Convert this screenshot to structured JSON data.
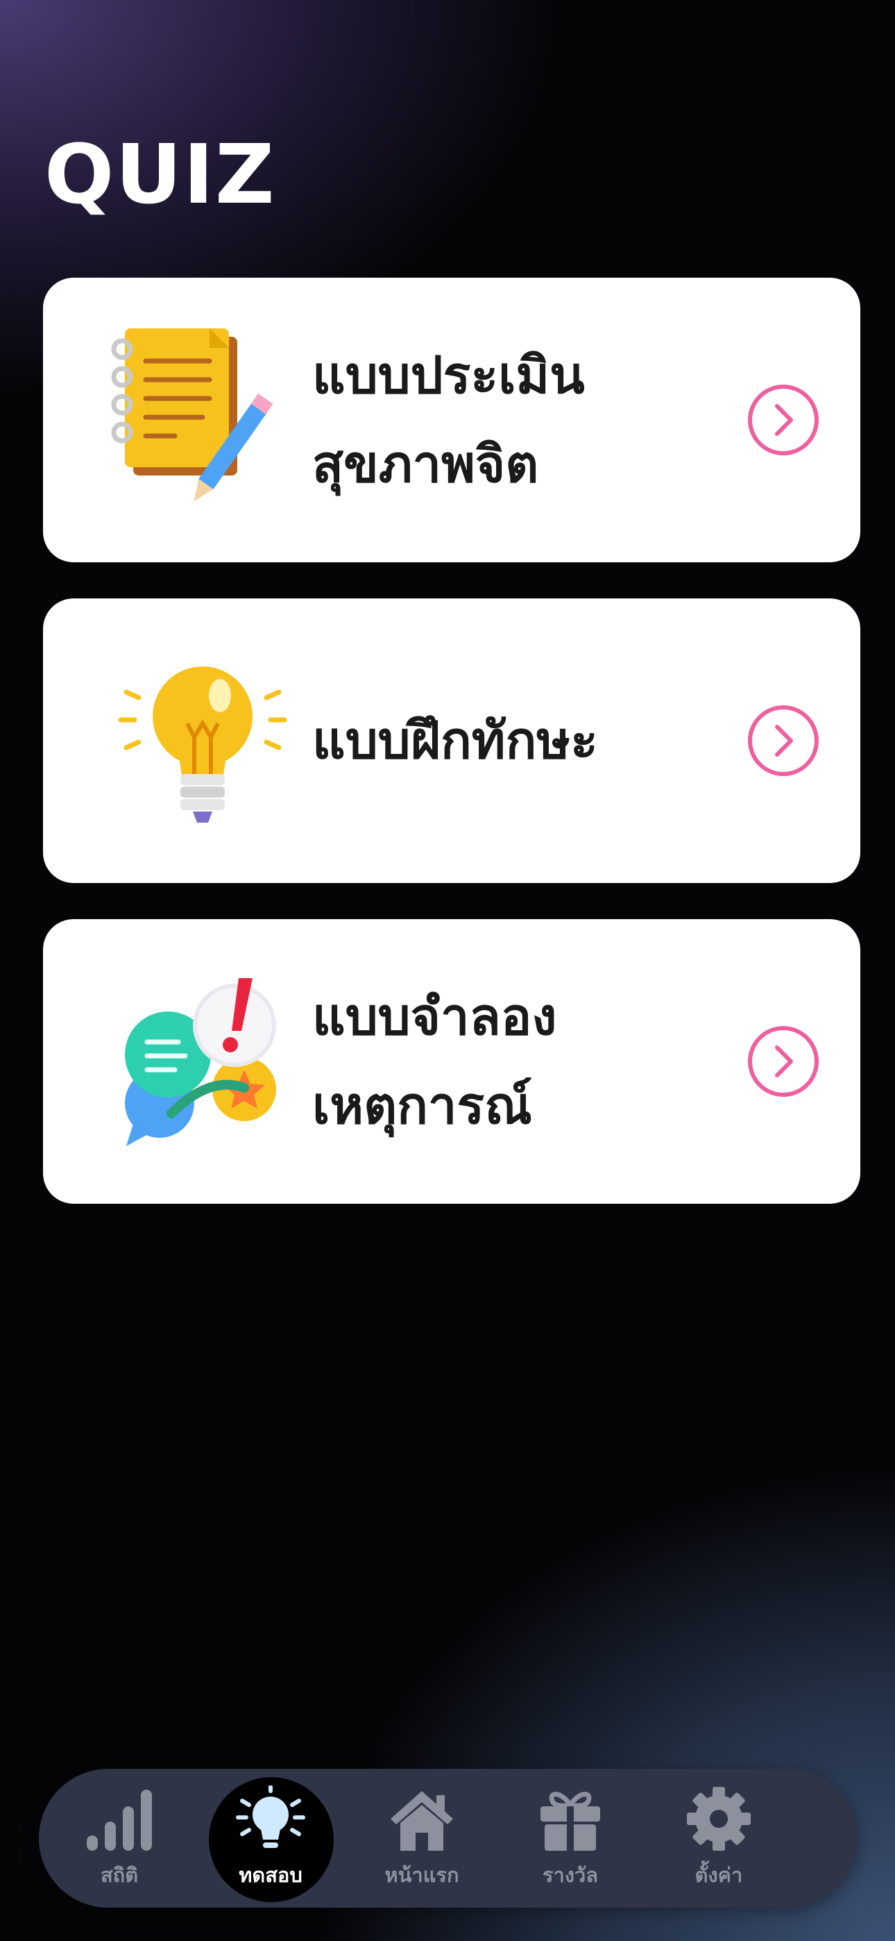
{
  "header": {
    "title": "QUIZ"
  },
  "quiz_items": [
    {
      "label_line1": "แบบประเมิน",
      "label_line2": "สุขภาพจิต",
      "icon": "notebook-pencil-icon"
    },
    {
      "label_line1": "แบบฝึกทักษะ",
      "icon": "lightbulb-icon"
    },
    {
      "label_line1": "แบบจำลอง",
      "label_line2": "เหตุการณ์",
      "icon": "chat-bubbles-icon"
    }
  ],
  "accent_color": "#ef5f9e",
  "nav": {
    "active": "ทดสอบ",
    "items": [
      {
        "label": "สถิติ",
        "icon": "bar-chart-icon"
      },
      {
        "label": "ทดสอบ",
        "icon": "lightbulb-icon"
      },
      {
        "label": "หน้าแรก",
        "icon": "home-icon"
      },
      {
        "label": "รางวัล",
        "icon": "gift-icon"
      },
      {
        "label": "ตั้งค่า",
        "icon": "gear-icon"
      }
    ]
  }
}
